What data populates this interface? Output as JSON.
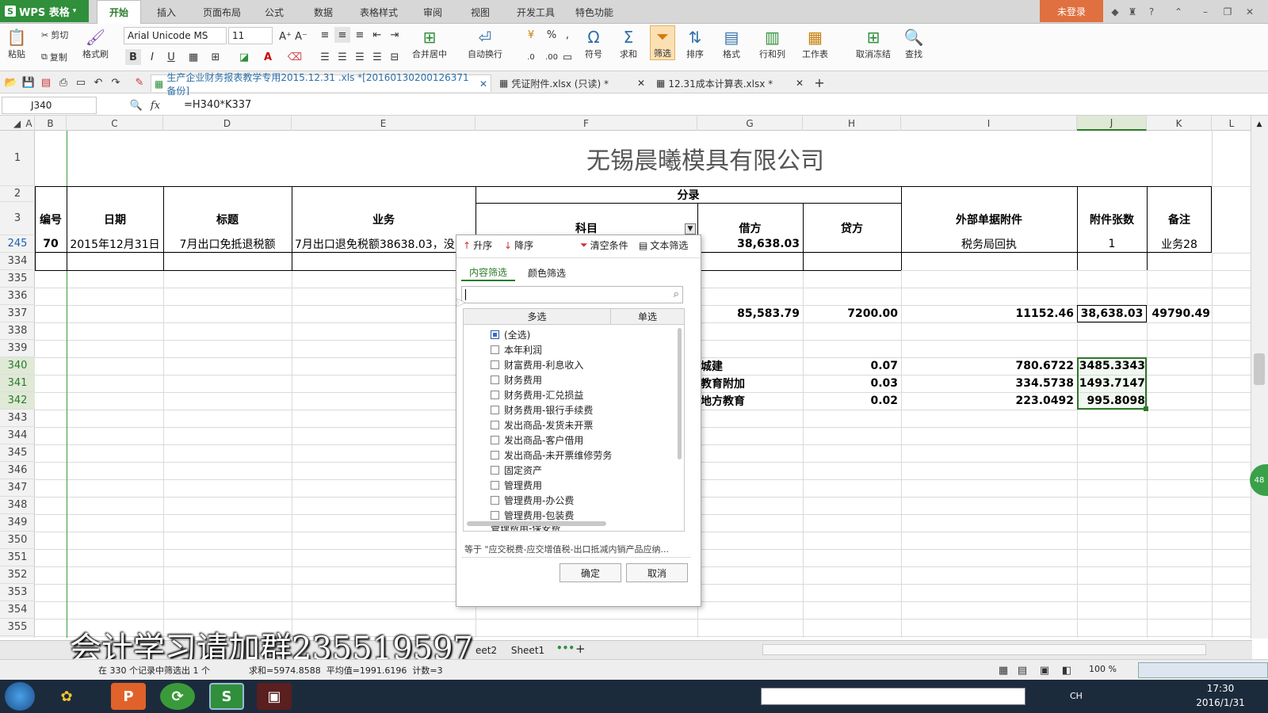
{
  "app": {
    "name": "WPS 表格",
    "login": "未登录"
  },
  "menu_tabs": [
    "开始",
    "插入",
    "页面布局",
    "公式",
    "数据",
    "表格样式",
    "审阅",
    "视图",
    "开发工具",
    "特色功能"
  ],
  "ribbon": {
    "paste": "粘贴",
    "cut": "剪切",
    "copy": "复制",
    "format_painter": "格式刷",
    "font_name": "Arial Unicode MS",
    "font_size": "11",
    "bold": "B",
    "italic": "I",
    "underline": "U",
    "merge_center": "合并居中",
    "wrap": "自动换行",
    "percent": "%",
    "symbol": "符号",
    "sum": "求和",
    "filter": "筛选",
    "sort": "排序",
    "format": "格式",
    "row_col": "行和列",
    "worksheet": "工作表",
    "unfreeze": "取消冻结",
    "find": "查找"
  },
  "doc_tabs": [
    {
      "label": "生产企业财务报表教学专用2015.12.31 .xls *[20160130200126371 备份]",
      "active": true
    },
    {
      "label": "凭证附件.xlsx (只读) *",
      "active": false
    },
    {
      "label": "12.31成本计算表.xlsx *",
      "active": false
    }
  ],
  "formula_bar": {
    "cell_ref": "J340",
    "fx": "fx",
    "formula": "=H340*K337"
  },
  "columns": [
    "A",
    "B",
    "C",
    "D",
    "E",
    "F",
    "G",
    "H",
    "I",
    "J",
    "K",
    "L"
  ],
  "rows": [
    "1",
    "2",
    "3",
    "245",
    "334",
    "335",
    "336",
    "337",
    "338",
    "339",
    "340",
    "341",
    "342",
    "343",
    "344",
    "345",
    "346",
    "347",
    "348",
    "349",
    "350",
    "351",
    "352",
    "353",
    "354",
    "355"
  ],
  "sheet": {
    "title": "无锡晨曦模具有限公司",
    "headers": {
      "no": "编号",
      "date": "日期",
      "subject": "标题",
      "business": "业务",
      "entry": "分录",
      "account": "科目",
      "debit": "借方",
      "credit": "贷方",
      "attachment": "外部单据附件",
      "count": "附件张数",
      "remark": "备注"
    },
    "row245": {
      "no": "70",
      "date": "2015年12月31日",
      "subject": "7月出口免抵退税额",
      "business": "7月出口退免税额38638.03，没",
      "debit": "38,638.03",
      "attachment": "税务局回执",
      "count": "1",
      "remark": "业务28"
    },
    "row337": {
      "g": "85,583.79",
      "h": "7200.00",
      "i": "11152.46",
      "j": "38,638.03",
      "k": "49790.49"
    },
    "row340": {
      "g": "城建",
      "h": "0.07",
      "i": "780.6722",
      "j": "3485.3343"
    },
    "row341": {
      "g": "教育附加",
      "h": "0.03",
      "i": "334.5738",
      "j": "1493.7147"
    },
    "row342": {
      "g": "地方教育",
      "h": "0.02",
      "i": "223.0492",
      "j": "995.8098"
    }
  },
  "filter_popup": {
    "asc": "升序",
    "desc": "降序",
    "clear": "清空条件",
    "text_filter": "文本筛选",
    "tab_content": "内容筛选",
    "tab_color": "颜色筛选",
    "search_placeholder": "",
    "col_multi": "多选",
    "col_single": "单选",
    "items": [
      "(全选)",
      "本年利润",
      "财富费用-利息收入",
      "财务费用",
      "财务费用-汇兑损益",
      "财务费用-银行手续费",
      "发出商品-发货未开票",
      "发出商品-客户借用",
      "发出商品-未开票维修劳务",
      "固定资产",
      "管理费用",
      "管理费用-办公费",
      "管理费用-包装费",
      "管理费用-保安费"
    ],
    "condition": "等于 \"应交税费-应交增值税-出口抵减内销产品应纳...",
    "ok": "确定",
    "cancel": "取消"
  },
  "sheet_tabs": [
    "eet2",
    "Sheet1"
  ],
  "status": {
    "records": "在 330 个记录中筛选出 1 个",
    "stats": "求和=5974.8588  平均值=1991.6196  计数=3",
    "zoom": "100 %"
  },
  "watermark": "会计学习请加群235519597",
  "taskbar": {
    "time": "17:30",
    "date": "2016/1/31",
    "lang": "CH"
  },
  "colors": {
    "accent_green": "#2f8f3a",
    "selection": "#2c7a2c",
    "login_bg": "#e07040"
  }
}
